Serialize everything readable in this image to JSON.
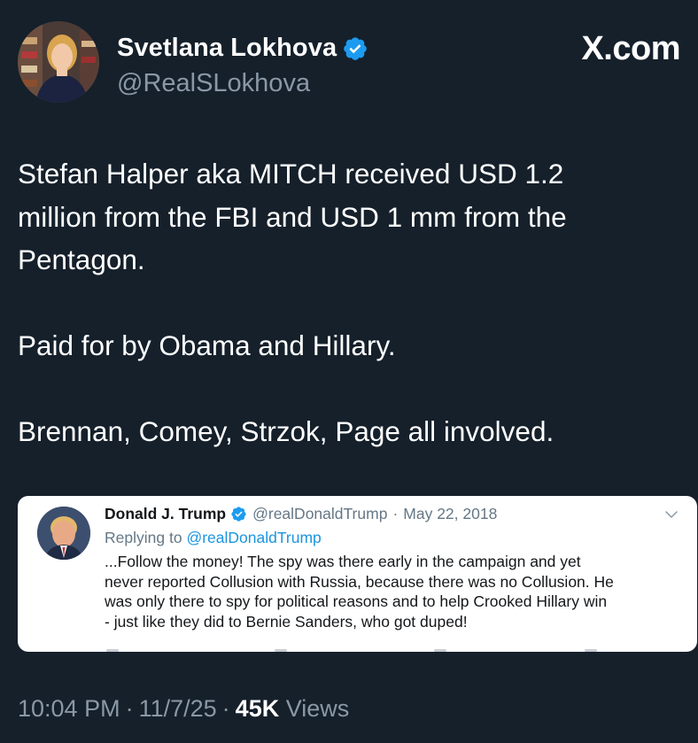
{
  "author": {
    "name": "Svetlana Lokhova",
    "handle": "@RealSLokhova",
    "verified": true
  },
  "brand": "X.com",
  "tweet": {
    "text": "Stefan Halper aka MITCH received USD 1.2\nmillion from the FBI and USD 1 mm from the\nPentagon.\n\nPaid for by Obama and Hillary.\n\nBrennan, Comey, Strzok, Page all involved."
  },
  "quoted": {
    "name": "Donald J. Trump",
    "handle": "@realDonaldTrump",
    "separator": "·",
    "date": "May 22, 2018",
    "replying_prefix": "Replying to",
    "replying_handle": "@realDonaldTrump",
    "text": "...Follow the money! The spy was there early in the campaign and yet\nnever reported Collusion with Russia, because there was no Collusion. He\nwas only there to spy for political reasons and to help Crooked Hillary win\n- just like they did to Bernie Sanders, who got duped!"
  },
  "meta": {
    "time": "10:04 PM",
    "date": "11/7/25",
    "separator": "·",
    "views_count": "45K",
    "views_label": "Views"
  },
  "colors": {
    "background": "#15202b",
    "verified_badge": "#1d9bf0",
    "secondary_text": "#8b98a5",
    "link_blue": "#1b95e0"
  },
  "icons": {
    "verified": "verified-badge-icon",
    "chevron": "chevron-down-icon"
  }
}
